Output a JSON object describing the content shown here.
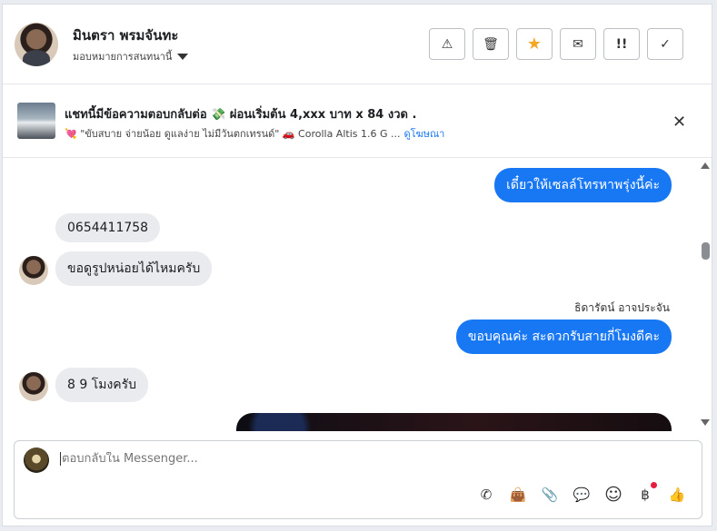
{
  "header": {
    "contact_name": "มินตรา พรมจันทะ",
    "assign_label": "มอบหมายการสนทนานี้",
    "actions": [
      {
        "icon": "warning-icon",
        "glyph": "⚠"
      },
      {
        "icon": "trash-icon",
        "glyph": "🗑"
      },
      {
        "icon": "star-icon",
        "glyph": "★",
        "color": "#f5a623"
      },
      {
        "icon": "mail-icon",
        "glyph": "✉"
      },
      {
        "icon": "follow-up-icon",
        "glyph": "!!"
      },
      {
        "icon": "check-icon",
        "glyph": "✓"
      }
    ]
  },
  "ad": {
    "title": "แชทนี้มีข้อความตอบกลับต่อ 💸 ผ่อนเริ่มต้น 4,xxx บาท x 84 งวด .",
    "subtitle": "💘 \"ขับสบาย จ่ายน้อย ดูแลง่าย ไม่มีวันตกเทรนด์\" 🚗 Corolla Altis 1.6 G ...",
    "link": "ดูโฆษณา",
    "close_glyph": "✕"
  },
  "messages": [
    {
      "direction": "out",
      "text": "เดี๋ยวให้เซลล์โทรหาพรุ่งนี้ค่ะ"
    },
    {
      "direction": "in",
      "text": "0654411758"
    },
    {
      "direction": "in",
      "text": "ขอดูรูปหน่อยได้ไหมครับ"
    },
    {
      "direction": "out",
      "sender": "ธิดารัตน์ อาจประจัน",
      "text": "ขอบคุณค่ะ สะดวกรับสายกี่โมงดีคะ"
    },
    {
      "direction": "in",
      "text": "8 9 โมงครับ"
    }
  ],
  "composer": {
    "placeholder": "ตอบกลับใน Messenger...",
    "tools": [
      {
        "icon": "call-add-icon",
        "glyph": "✆"
      },
      {
        "icon": "shopping-bag-icon",
        "glyph": "👜"
      },
      {
        "icon": "paperclip-icon",
        "glyph": "📎"
      },
      {
        "icon": "saved-reply-icon",
        "glyph": "💬"
      },
      {
        "icon": "emoji-icon",
        "glyph": "☺"
      },
      {
        "icon": "baht-payment-icon",
        "glyph": "฿"
      },
      {
        "icon": "thumbs-up-icon",
        "glyph": "👍"
      }
    ]
  },
  "colors": {
    "accent": "#1877f2",
    "incoming_bubble": "#e9ebee",
    "notification_dot": "#e41e3f"
  }
}
